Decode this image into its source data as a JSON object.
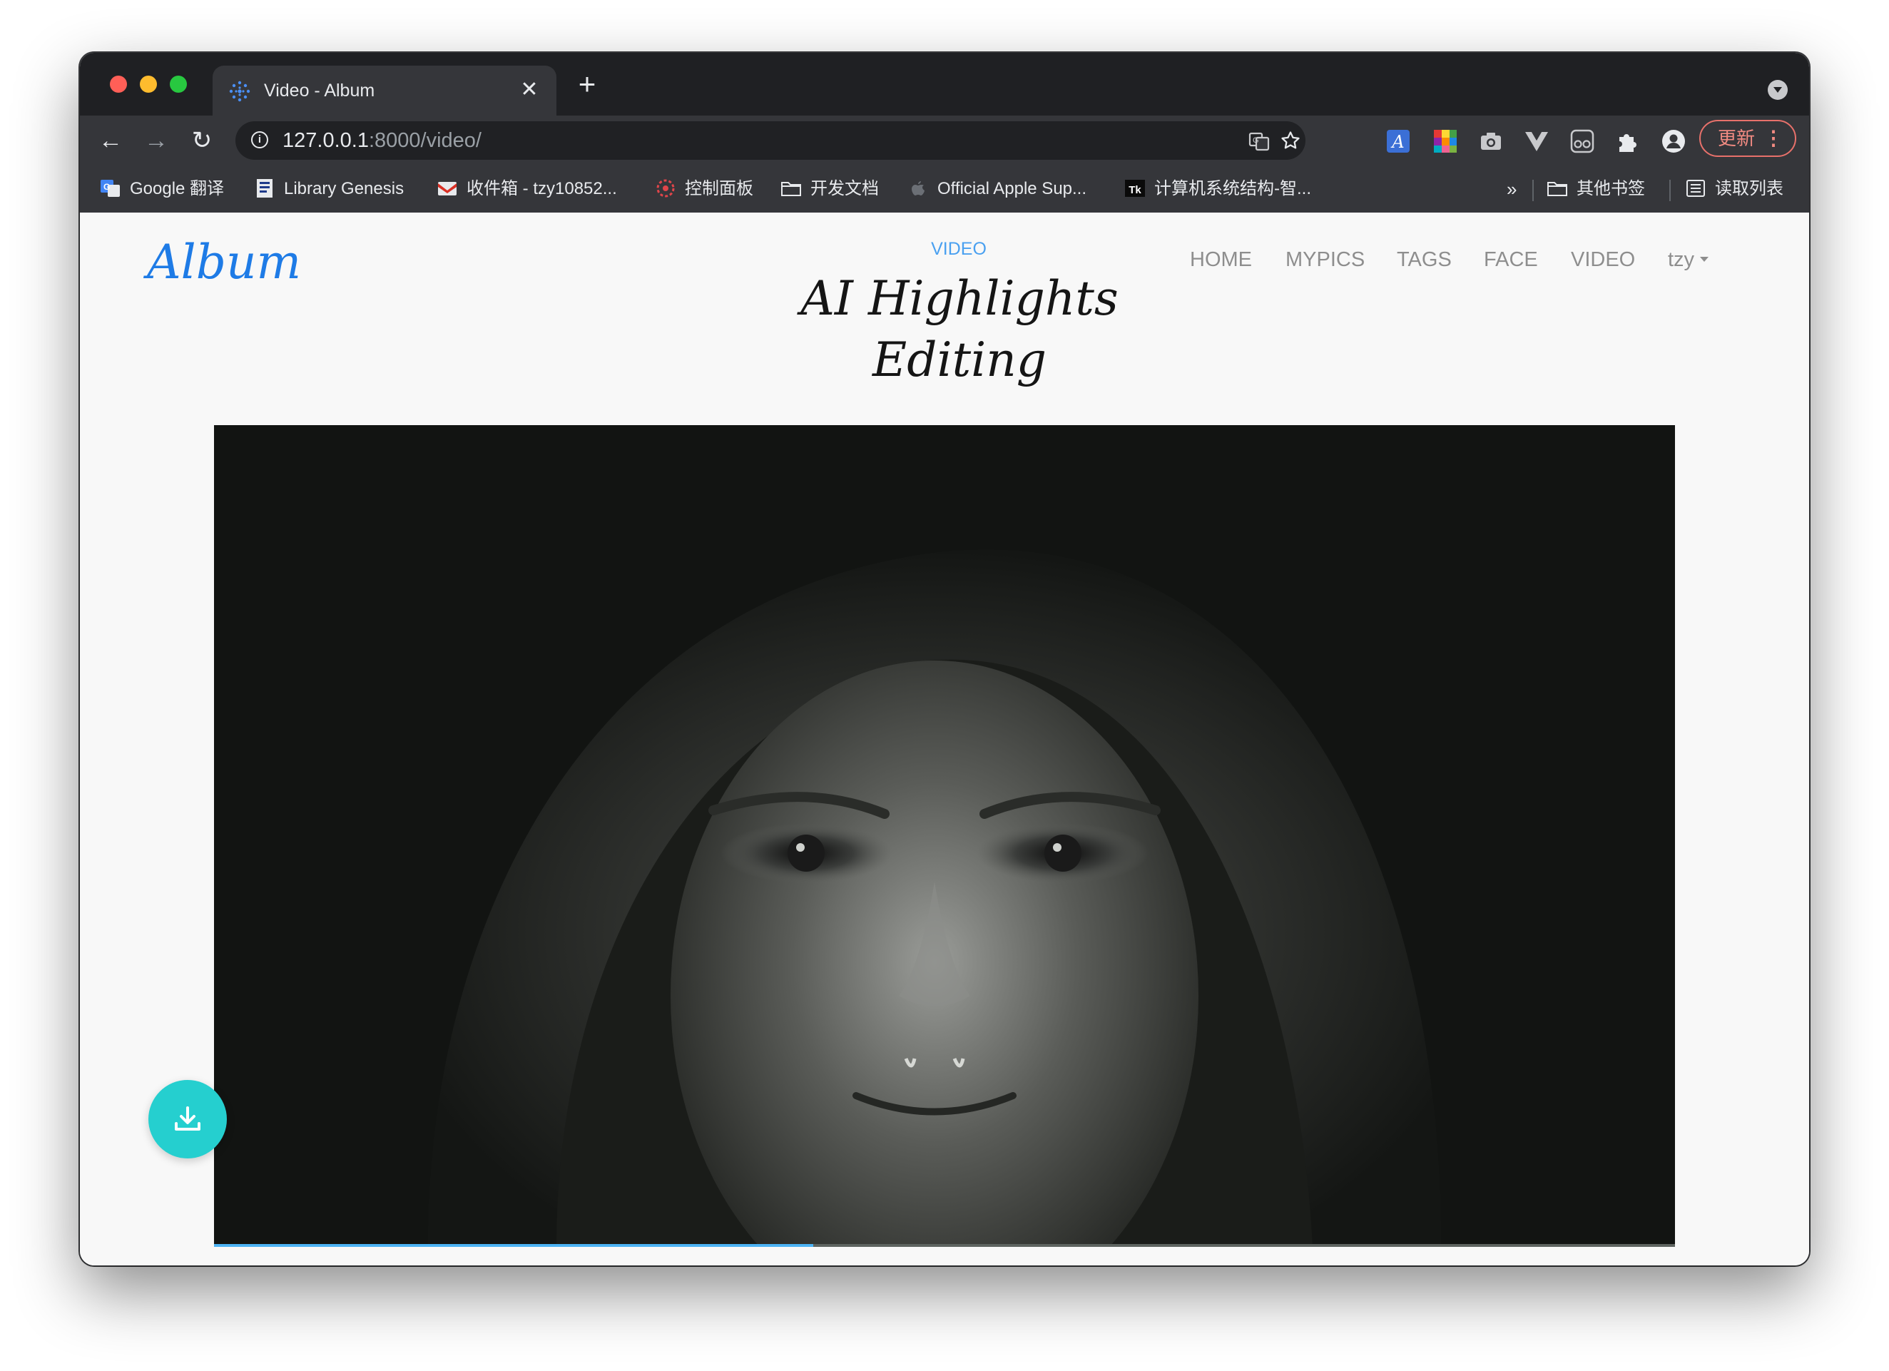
{
  "browser": {
    "tab_title": "Video - Album",
    "tab_close": "✕",
    "new_tab": "+",
    "url_host": "127.0.0.1",
    "url_rest": ":8000/video/",
    "update_label": "更新",
    "update_menu": "⋮",
    "back": "←",
    "forward": "→",
    "reload": "↻"
  },
  "bookmarks": [
    {
      "label": "Google 翻译",
      "icon": "google-translate-icon"
    },
    {
      "label": "Library Genesis",
      "icon": "library-genesis-icon"
    },
    {
      "label": "收件箱 - tzy10852...",
      "icon": "gmail-icon"
    },
    {
      "label": "控制面板",
      "icon": "control-panel-icon"
    },
    {
      "label": "开发文档",
      "icon": "folder-icon"
    },
    {
      "label": "Official Apple Sup...",
      "icon": "apple-icon"
    },
    {
      "label": "计算机系统结构-智...",
      "icon": "tk-icon"
    }
  ],
  "bookmarks_more": "»",
  "bookmarks_other": "其他书签",
  "bookmarks_reading": "读取列表",
  "site": {
    "brand": "Album",
    "kicker": "VIDEO",
    "headline": "AI Highlights Editing",
    "nav": [
      "HOME",
      "MYPICS",
      "TAGS",
      "FACE",
      "VIDEO"
    ],
    "user": "tzy"
  },
  "video": {
    "progress": 0.41
  },
  "colors": {
    "accent": "#1e7be6",
    "kicker": "#4aa0f0",
    "fab": "#25cfcf",
    "progress": "#4cb3f4"
  }
}
